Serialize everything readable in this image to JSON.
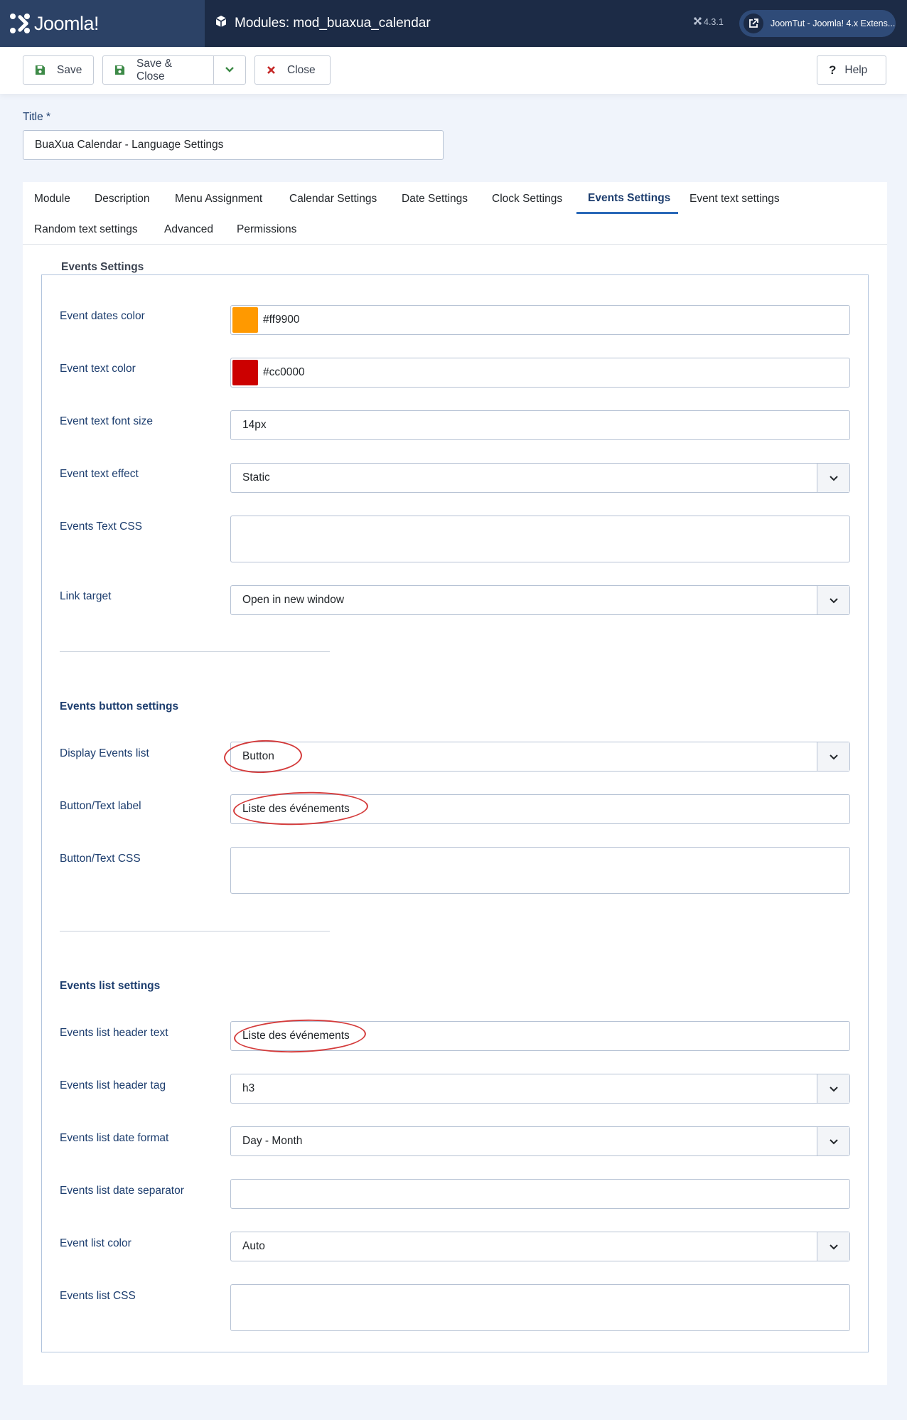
{
  "header": {
    "brand": "Joomla!",
    "title": "Modules: mod_buaxua_calendar",
    "version": "4.3.1",
    "user_link": "JoomTut - Joomla! 4.x Extens..."
  },
  "toolbar": {
    "save_label": "Save",
    "save_close_label": "Save & Close",
    "close_label": "Close",
    "help_label": "Help"
  },
  "title_field": {
    "label": "Title *",
    "value": "BuaXua Calendar - Language Settings"
  },
  "tabs": [
    {
      "label": "Module"
    },
    {
      "label": "Description"
    },
    {
      "label": "Menu Assignment"
    },
    {
      "label": "Calendar Settings"
    },
    {
      "label": "Date Settings"
    },
    {
      "label": "Clock Settings"
    },
    {
      "label": "Events Settings",
      "active": true
    },
    {
      "label": "Event text settings"
    },
    {
      "label": "Random text settings"
    },
    {
      "label": "Advanced"
    },
    {
      "label": "Permissions"
    }
  ],
  "events": {
    "legend": "Events Settings",
    "dates_color": {
      "label": "Event dates color",
      "value": "#ff9900"
    },
    "text_color": {
      "label": "Event text color",
      "value": "#cc0000"
    },
    "font_size": {
      "label": "Event text font size",
      "value": "14px"
    },
    "text_effect": {
      "label": "Event text effect",
      "value": "Static"
    },
    "text_css": {
      "label": "Events Text CSS",
      "value": ""
    },
    "link_target": {
      "label": "Link target",
      "value": "Open in new window"
    }
  },
  "button_settings": {
    "heading": "Events button settings",
    "display_list": {
      "label": "Display Events list",
      "value": "Button"
    },
    "text_label": {
      "label": "Button/Text label",
      "value": "Liste des événements"
    },
    "text_css": {
      "label": "Button/Text CSS",
      "value": ""
    }
  },
  "list_settings": {
    "heading": "Events list settings",
    "header_text": {
      "label": "Events list header text",
      "value": "Liste des événements"
    },
    "header_tag": {
      "label": "Events list header tag",
      "value": "h3"
    },
    "date_format": {
      "label": "Events list date format",
      "value": "Day - Month"
    },
    "date_separator": {
      "label": "Events list date separator",
      "value": ""
    },
    "list_color": {
      "label": "Event list color",
      "value": "Auto"
    },
    "list_css": {
      "label": "Events list CSS",
      "value": ""
    }
  },
  "colors": {
    "header_bg": "#1c2b46",
    "brand_bg": "#2c4266",
    "accent": "#2a69b8",
    "highlight": "#d43c3c"
  },
  "icons": {
    "brand": "joomla-logo-icon",
    "module": "cube-icon",
    "version": "joomla-small-icon",
    "user": "external-link-icon",
    "save": "floppy-disk-icon",
    "save_close": "floppy-disk-icon",
    "dropdown": "chevron-down-icon",
    "close": "close-icon",
    "help": "question-icon"
  }
}
